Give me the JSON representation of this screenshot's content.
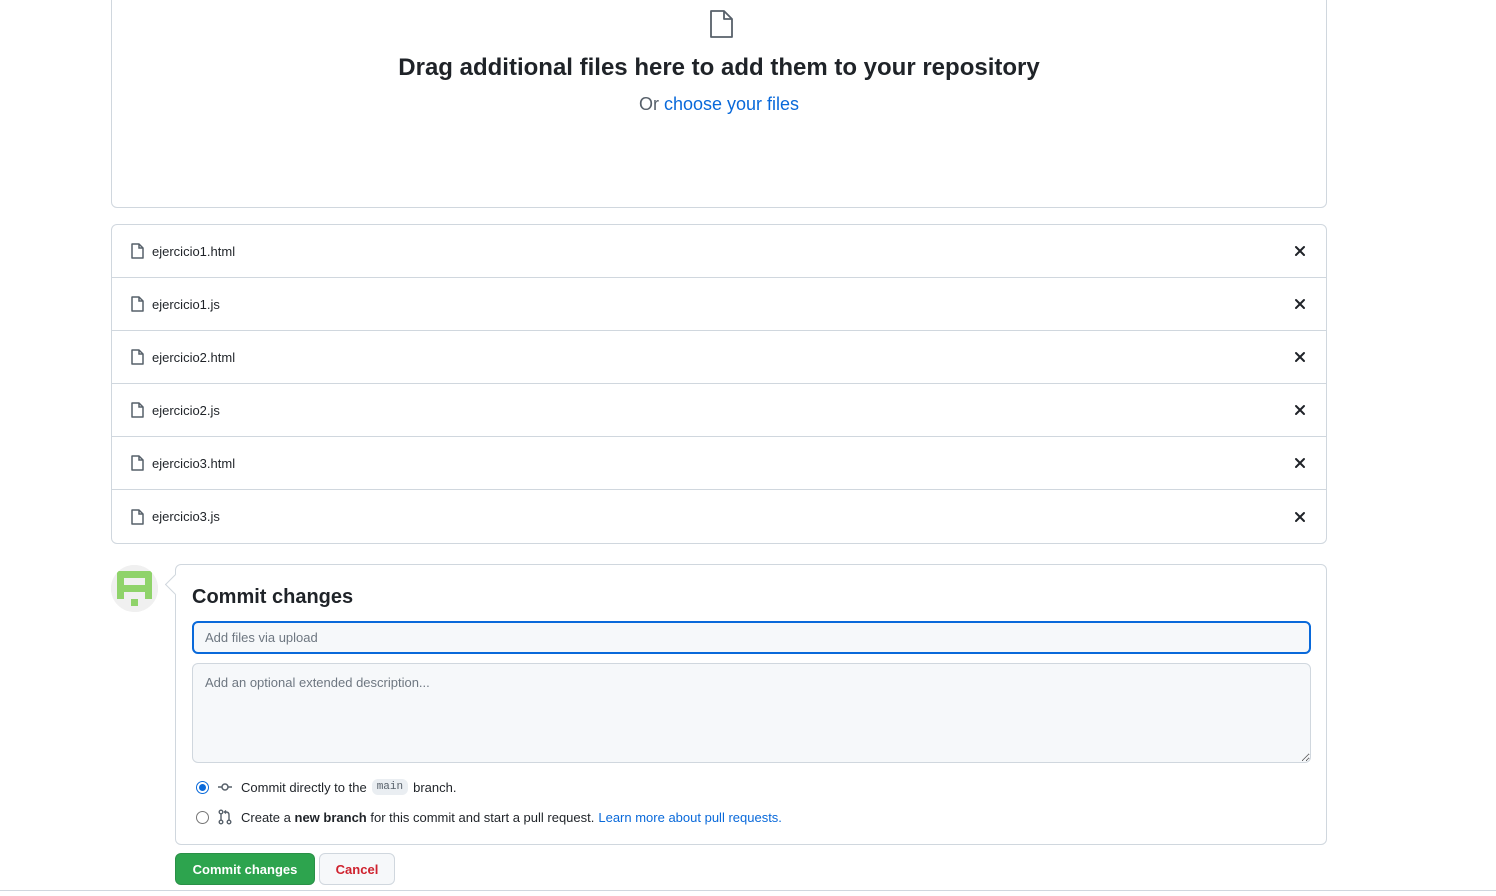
{
  "dropzone": {
    "title": "Drag additional files here to add them to your repository",
    "sub_prefix": "Or",
    "choose_link": "choose your files",
    "icon": "file-icon"
  },
  "files": [
    {
      "name": "ejercicio1.html"
    },
    {
      "name": "ejercicio1.js"
    },
    {
      "name": "ejercicio2.html"
    },
    {
      "name": "ejercicio2.js"
    },
    {
      "name": "ejercicio3.html"
    },
    {
      "name": "ejercicio3.js"
    }
  ],
  "commit": {
    "title": "Commit changes",
    "summary_placeholder": "Add files via upload",
    "description_placeholder": "Add an optional extended description...",
    "option_direct": {
      "prefix": "Commit directly to the",
      "branch": "main",
      "suffix": "branch.",
      "selected": true
    },
    "option_new_branch": {
      "prefix": "Create a",
      "bold": "new branch",
      "suffix": "for this commit and start a pull request.",
      "link": "Learn more about pull requests.",
      "selected": false
    },
    "commit_button": "Commit changes",
    "cancel_button": "Cancel"
  },
  "colors": {
    "accent": "#0969da",
    "commit_green": "#2da44e",
    "cancel_red": "#cf222e",
    "avatar_green": "#8fd36a"
  }
}
